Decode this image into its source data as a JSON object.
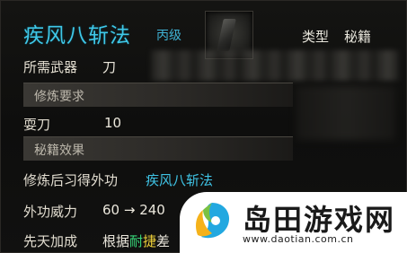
{
  "skill": {
    "name": "疾风八斩法",
    "grade": "丙级",
    "type_label": "类型",
    "type_value": "秘籍",
    "weapon_label": "所需武器",
    "weapon_value": "刀"
  },
  "requirements": {
    "section_title": "修炼要求",
    "label": "耍刀",
    "value": "10"
  },
  "effects": {
    "section_title": "秘籍效果",
    "learn_label": "修炼后习得外功",
    "learn_value": "疾风八斩法",
    "power_label": "外功威力",
    "power_value": "60 → 240",
    "innate_label": "先天加成",
    "innate_prefix": "根据",
    "innate_green": "耐",
    "innate_yellow": "捷",
    "innate_suffix": "差"
  },
  "watermark": {
    "name": "岛田游戏网",
    "url": "www.daotian.com.cn"
  },
  "colors": {
    "title_cyan": "#3fc8e8",
    "green": "#38d87a",
    "yellow": "#f0d23a"
  }
}
